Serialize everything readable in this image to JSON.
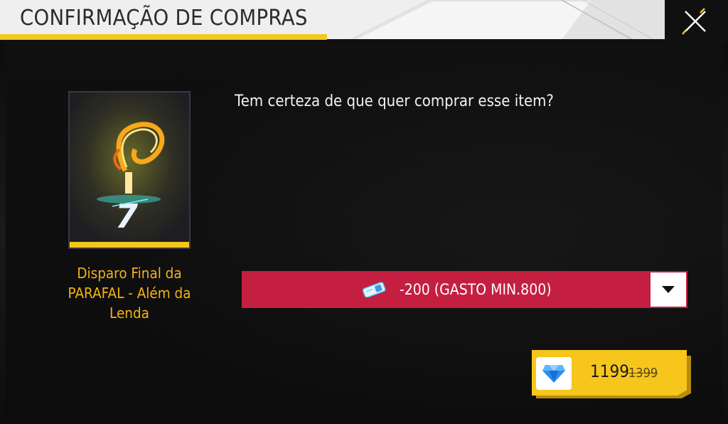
{
  "header": {
    "title": "CONFIRMAÇÃO DE COMPRAS"
  },
  "item": {
    "name": "Disparo Final da PARAFAL - Além da Lenda"
  },
  "dialog": {
    "question": "Tem certeza de que quer comprar esse item?"
  },
  "voucher": {
    "selected_label": "-200 (GASTO MIN.800)"
  },
  "purchase": {
    "price": "1199",
    "original_price": "1399"
  },
  "icons": {
    "close": "close-icon",
    "voucher": "voucher-ticket-icon",
    "dropdown": "triangle-down-icon",
    "currency": "diamond-icon"
  },
  "colors": {
    "accent_yellow": "#f4c71b",
    "voucher_red": "#c41f41",
    "item_name": "#f4b316",
    "diamond_blue": "#2a8df0"
  }
}
